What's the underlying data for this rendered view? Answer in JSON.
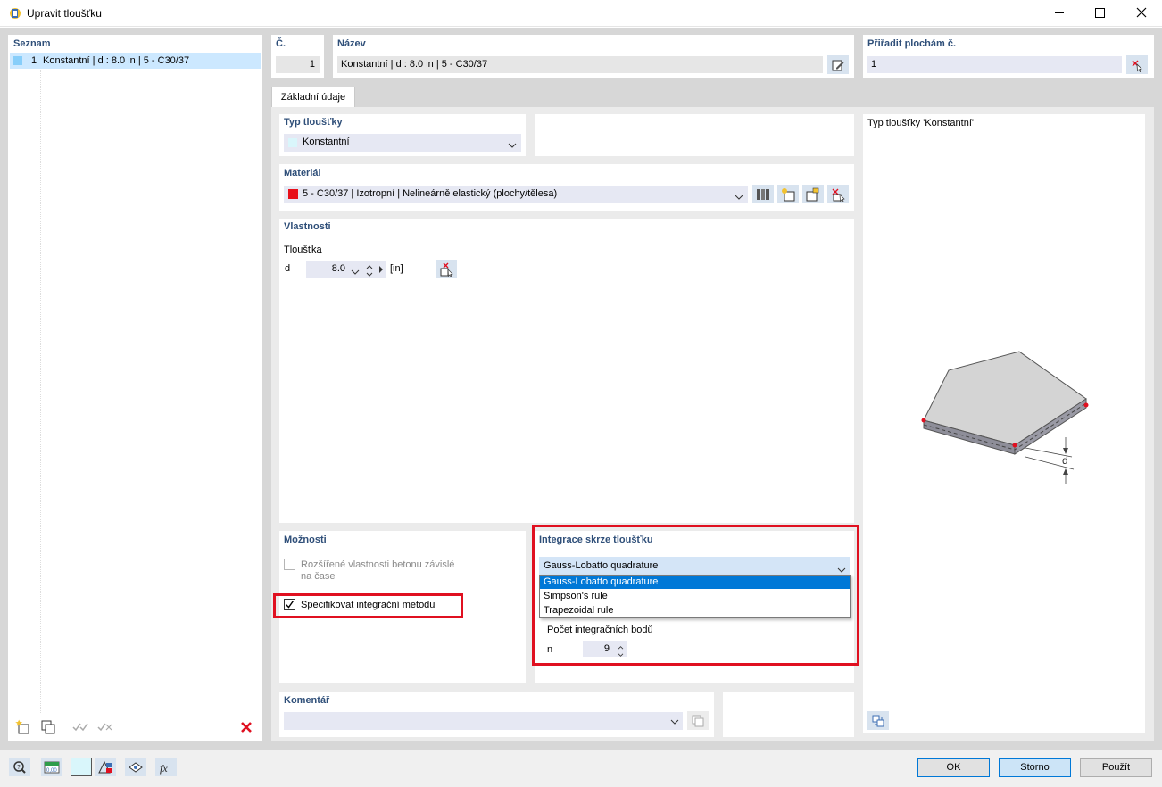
{
  "window": {
    "title": "Upravit tloušťku",
    "controls": [
      "minimize",
      "maximize",
      "close"
    ]
  },
  "list": {
    "header": "Seznam",
    "items": [
      {
        "number": "1",
        "label": "Konstantní | d : 8.0 in | 5 - C30/37",
        "color": "#87cefa"
      }
    ]
  },
  "header": {
    "no_label": "Č.",
    "no_value": "1",
    "name_label": "Název",
    "name_value": "Konstantní | d : 8.0 in | 5 - C30/37",
    "assign_label": "Přiřadit plochám č.",
    "assign_value": "1"
  },
  "tabs": [
    {
      "label": "Základní údaje",
      "active": true
    }
  ],
  "thickness_type": {
    "label": "Typ tloušťky",
    "value": "Konstantní",
    "swatch": "#d9f6fb"
  },
  "material": {
    "label": "Materiál",
    "value": "5 - C30/37 | Izotropní | Nelineárně elastický (plochy/tělesa)",
    "swatch": "#e8101a"
  },
  "properties": {
    "label": "Vlastnosti",
    "thickness_label": "Tloušťka",
    "symbol": "d",
    "value": "8.0",
    "unit": "[in]"
  },
  "options": {
    "label": "Možnosti",
    "items": [
      {
        "label": "Rozšířené vlastnosti betonu závislé",
        "label2": "na čase",
        "checked": false,
        "enabled": false
      },
      {
        "label": "Specifikovat integrační metodu",
        "checked": true,
        "enabled": true
      }
    ]
  },
  "integration": {
    "label": "Integrace skrze tloušťku",
    "selected": "Gauss-Lobatto quadrature",
    "options": [
      "Gauss-Lobatto quadrature",
      "Simpson's rule",
      "Trapezoidal rule"
    ],
    "highlighted_option": "Gauss-Lobatto quadrature",
    "points_label": "Počet integračních bodů",
    "points_symbol": "n",
    "points_value": "9"
  },
  "comment": {
    "label": "Komentář",
    "value": ""
  },
  "preview": {
    "title": "Typ tloušťky  'Konstantní'",
    "dimension_label": "d"
  },
  "buttons": {
    "ok": "OK",
    "cancel": "Storno",
    "apply": "Použít"
  },
  "colors": {
    "highlight_red": "#e01020",
    "selection_blue": "#0078d7",
    "label_blue": "#2f4f79",
    "panel_gray": "#d7d7d7"
  }
}
